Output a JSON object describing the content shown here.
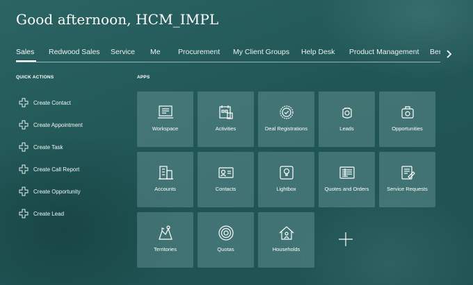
{
  "greeting": "Good afternoon, HCM_IMPL",
  "tabs": [
    {
      "label": "Sales"
    },
    {
      "label": "Redwood Sales"
    },
    {
      "label": "Service"
    },
    {
      "label": "Me"
    },
    {
      "label": "Procurement"
    },
    {
      "label": "My Client Groups"
    },
    {
      "label": "Help Desk"
    },
    {
      "label": "Product Management"
    },
    {
      "label": "Ber"
    }
  ],
  "quick_actions": {
    "title": "QUICK ACTIONS",
    "items": [
      {
        "label": "Create Contact"
      },
      {
        "label": "Create Appointment"
      },
      {
        "label": "Create Task"
      },
      {
        "label": "Create Call Report"
      },
      {
        "label": "Create Opportunity"
      },
      {
        "label": "Create Lead"
      }
    ]
  },
  "apps": {
    "title": "APPS",
    "tiles": [
      {
        "label": "Workspace",
        "icon": "workspace-icon"
      },
      {
        "label": "Activities",
        "icon": "activities-icon"
      },
      {
        "label": "Deal Registrations",
        "icon": "deal-registrations-icon"
      },
      {
        "label": "Leads",
        "icon": "leads-icon"
      },
      {
        "label": "Opportunities",
        "icon": "opportunities-icon"
      },
      {
        "label": "Accounts",
        "icon": "accounts-icon"
      },
      {
        "label": "Contacts",
        "icon": "contacts-icon"
      },
      {
        "label": "Lightbox",
        "icon": "lightbox-icon"
      },
      {
        "label": "Quotes and Orders",
        "icon": "quotes-orders-icon"
      },
      {
        "label": "Service Requests",
        "icon": "service-requests-icon"
      },
      {
        "label": "Territories",
        "icon": "territories-icon"
      },
      {
        "label": "Quotas",
        "icon": "quotas-icon"
      },
      {
        "label": "Households",
        "icon": "households-icon"
      }
    ],
    "add_icon": "plus-icon"
  }
}
